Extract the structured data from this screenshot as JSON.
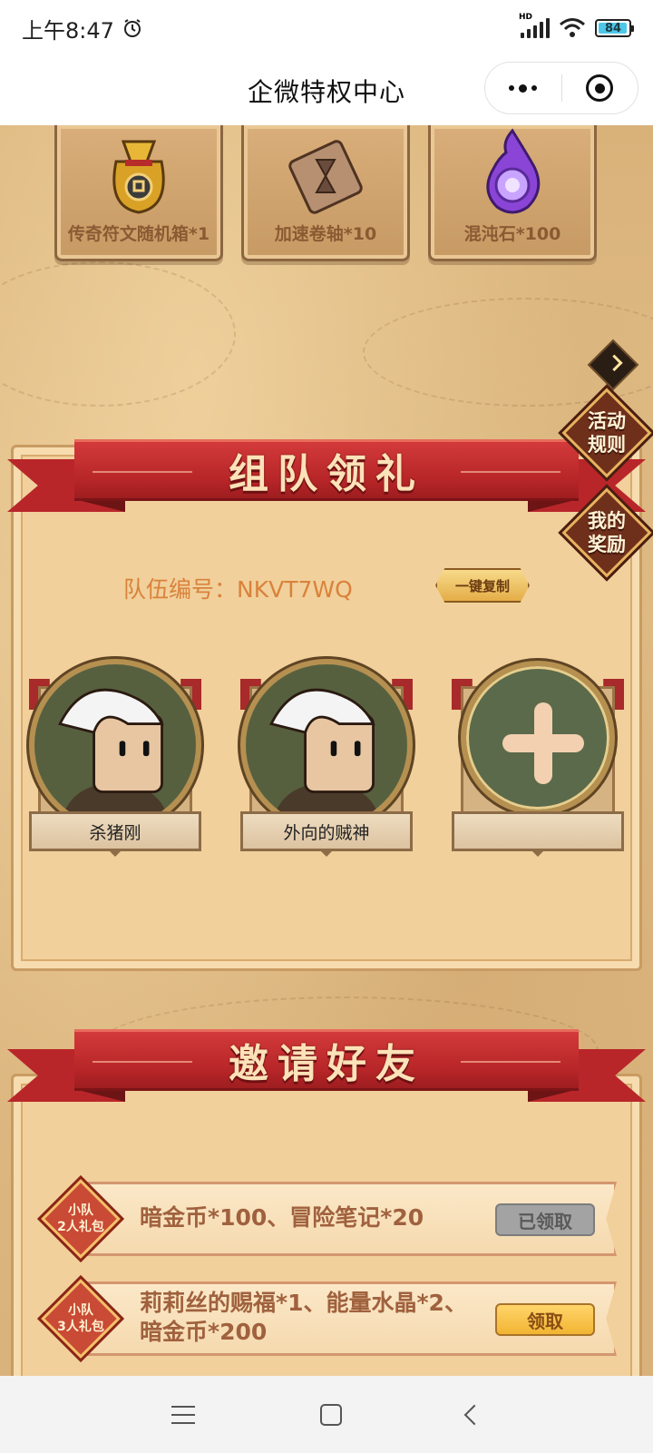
{
  "status_bar": {
    "time": "上午8:47",
    "network": "HD",
    "battery": "84"
  },
  "nav": {
    "title": "企微特权中心"
  },
  "rewards": [
    {
      "label": "传奇符文随机箱*1",
      "icon": "bag-icon"
    },
    {
      "label": "加速卷轴*10",
      "icon": "scroll-icon"
    },
    {
      "label": "混沌石*100",
      "icon": "purple-flame-icon"
    }
  ],
  "side": {
    "rules": [
      "活动",
      "规则"
    ],
    "my_rewards": [
      "我的",
      "奖励"
    ]
  },
  "team": {
    "title": "组队领礼",
    "id_label": "队伍编号：",
    "id_value": "NKVT7WQ",
    "copy_label": "一键复制",
    "members": [
      {
        "name": "杀猪刚"
      },
      {
        "name": "外向的贼神"
      },
      {
        "name": ""
      }
    ]
  },
  "invite": {
    "title": "邀请好友",
    "gifts": [
      {
        "badge": [
          "小队",
          "2人礼包"
        ],
        "lines": [
          "暗金币*100、冒险笔记*20"
        ],
        "button": "已领取",
        "state": "claimed"
      },
      {
        "badge": [
          "小队",
          "3人礼包"
        ],
        "lines": [
          "莉莉丝的赐福*1、能量水晶*2、",
          "暗金币*200"
        ],
        "button": "领取",
        "state": "claim"
      }
    ]
  },
  "colors": {
    "ribbon": "#b8262a",
    "panel": "#f1d09b",
    "accent": "#d9823b"
  }
}
